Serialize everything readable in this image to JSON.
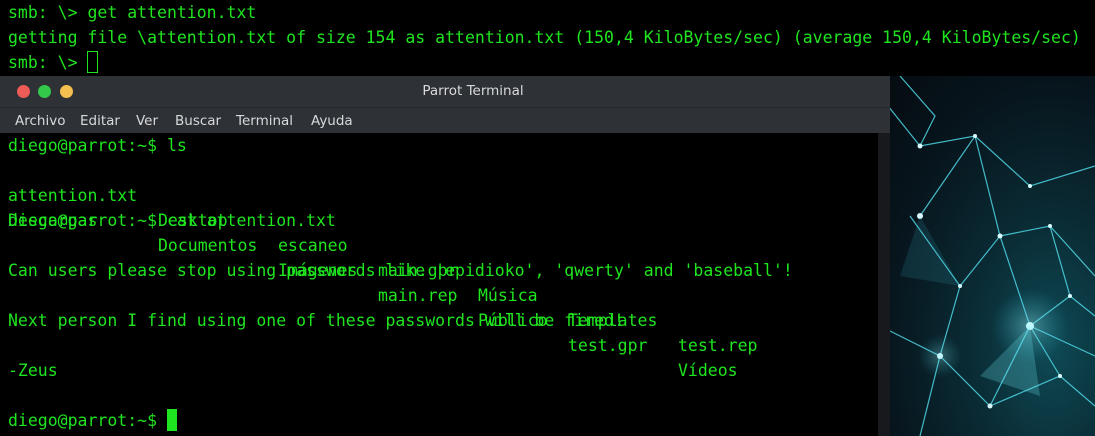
{
  "background_terminal": {
    "lines": [
      "smb: \\> get attention.txt",
      "getting file \\attention.txt of size 154 as attention.txt (150,4 KiloBytes/sec) (average 150,4 KiloBytes/sec)"
    ],
    "prompt": "smb: \\> "
  },
  "window": {
    "title": "Parrot Terminal",
    "menu": [
      "Archivo",
      "Editar",
      "Ver",
      "Buscar",
      "Terminal",
      "Ayuda"
    ]
  },
  "terminal": {
    "prompt": "diego@parrot:~$ ",
    "cmd_ls": "ls",
    "ls_row1": [
      "attention.txt",
      "Desktop",
      "escaneo",
      "main.gpr",
      "Música",
      "Templates",
      "test.rep"
    ],
    "ls_row2": [
      "Descargas",
      "Documentos",
      "Imágenes",
      "main.rep",
      "Público",
      "test.gpr",
      "Vídeos"
    ],
    "cmd_cat": "cat attention.txt",
    "file_lines": [
      "Can users please stop using passwords like 'epidioko', 'qwerty' and 'baseball'!",
      "Next person I find using one of these passwords will be fired!",
      "-Zeus"
    ]
  },
  "colors": {
    "terminal_green": "#1fe51f",
    "titlebar": "#2e3136",
    "close": "#ed5c57",
    "minimize": "#34c84a",
    "maximize": "#f4bf4f"
  }
}
